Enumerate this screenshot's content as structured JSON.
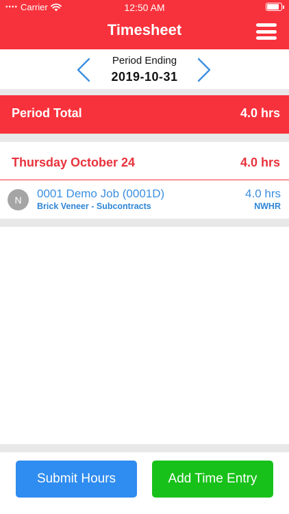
{
  "status_bar": {
    "carrier": "Carrier",
    "time": "12:50 AM",
    "battery_level": 0.9
  },
  "header": {
    "title": "Timesheet",
    "menu_icon": "hamburger-menu-icon"
  },
  "period": {
    "label": "Period Ending",
    "date": "2019-10-31",
    "prev_icon": "chevron-left-icon",
    "next_icon": "chevron-right-icon"
  },
  "period_total": {
    "label": "Period Total",
    "value": "4.0 hrs"
  },
  "days": [
    {
      "label": "Thursday October 24",
      "total": "4.0 hrs",
      "entries": [
        {
          "avatar": "N",
          "job": "0001 Demo Job (0001D)",
          "task": "Brick Veneer - Subcontracts",
          "hours": "4.0 hrs",
          "code": "NWHR"
        }
      ]
    }
  ],
  "footer": {
    "submit_label": "Submit Hours",
    "add_label": "Add Time Entry"
  },
  "colors": {
    "accent_red": "#f8323c",
    "link_blue": "#3b8fe0",
    "submit_blue": "#2f8cf0",
    "add_green": "#18c11a"
  }
}
